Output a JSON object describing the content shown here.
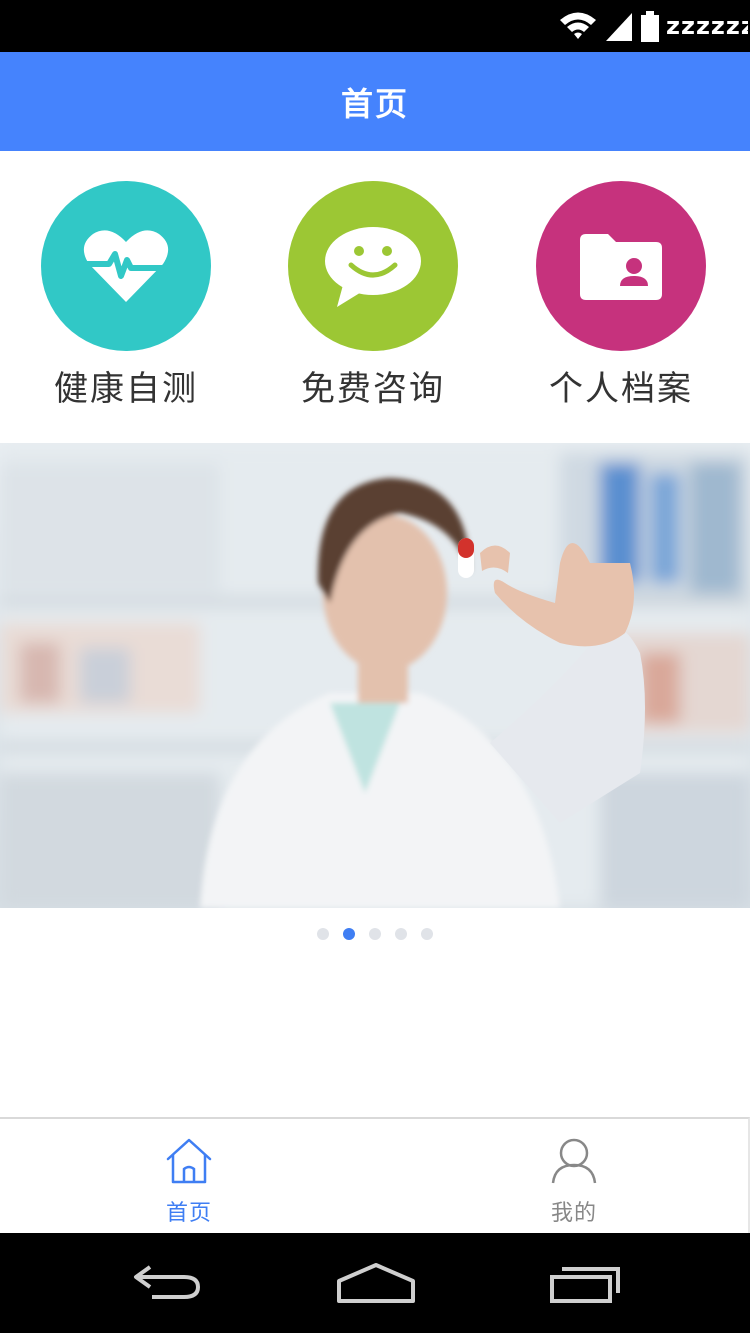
{
  "status_bar": {
    "carrier_text": "zzzzzz"
  },
  "app_bar": {
    "title": "首页"
  },
  "shortcuts": [
    {
      "label": "健康自测",
      "icon": "heart-pulse-icon",
      "color": "#31c8c6"
    },
    {
      "label": "免费咨询",
      "icon": "chat-smile-icon",
      "color": "#9cc734"
    },
    {
      "label": "个人档案",
      "icon": "profile-folder-icon",
      "color": "#c6327d"
    }
  ],
  "banner": {
    "description_icon": "doctor-holding-pill-photo",
    "active_slide": 2,
    "slide_count": 5
  },
  "tab_bar": {
    "tabs": [
      {
        "label": "首页",
        "icon": "home-icon",
        "active": true,
        "color": "#3f7ef3"
      },
      {
        "label": "我的",
        "icon": "user-icon",
        "active": false,
        "color": "#888888"
      }
    ]
  },
  "system_nav": {
    "back_icon": "back-icon",
    "home_icon": "home-nav-icon",
    "recents_icon": "recents-icon"
  }
}
